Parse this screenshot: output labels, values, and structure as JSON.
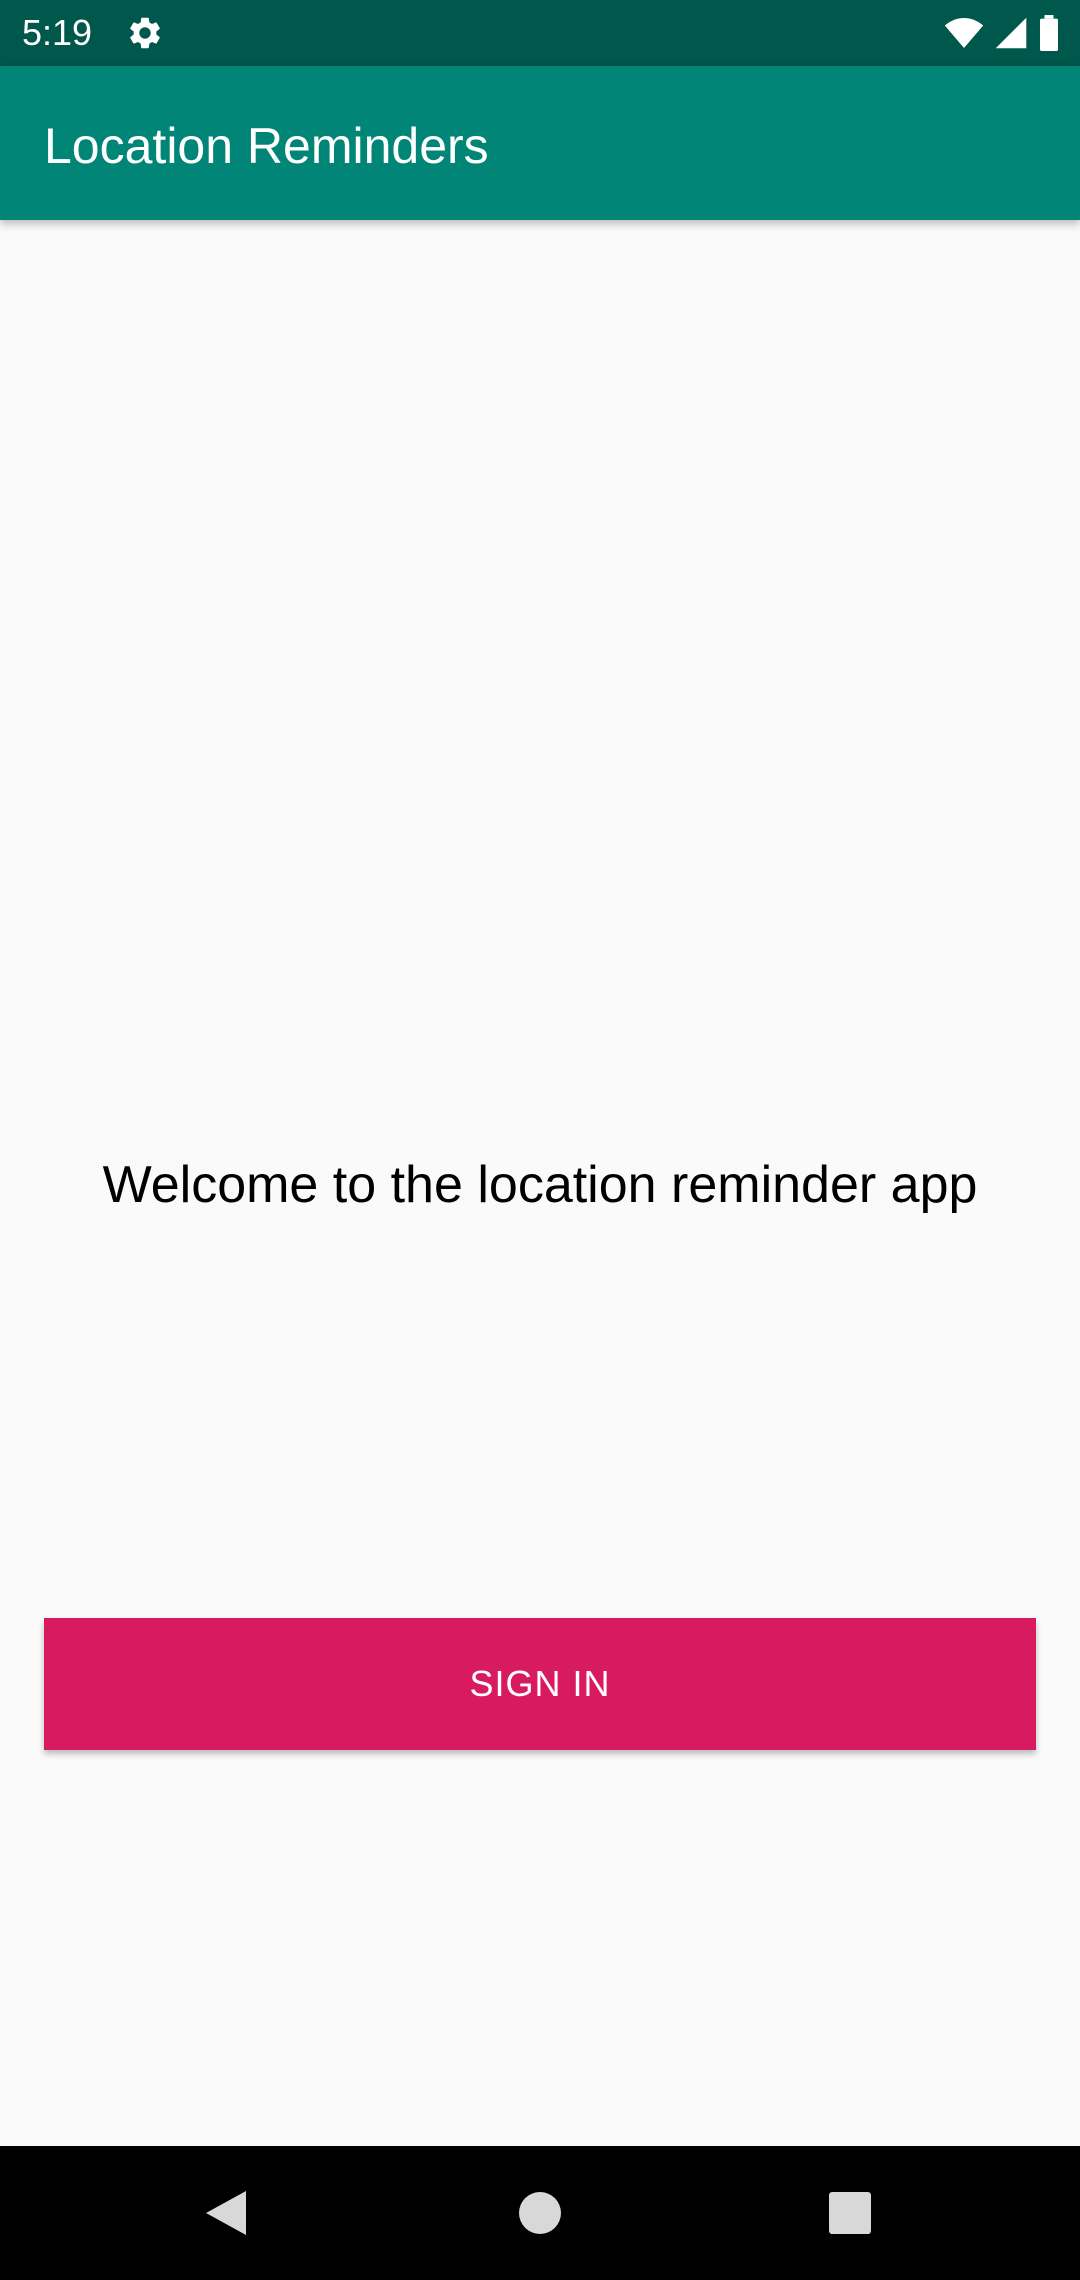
{
  "status_bar": {
    "time": "5:19",
    "icons": [
      "gear-icon",
      "wifi-icon",
      "signal-icon",
      "battery-icon"
    ],
    "background": "#00574b"
  },
  "app_bar": {
    "title": "Location Reminders",
    "background": "#008577"
  },
  "main": {
    "welcome_text": "Welcome to the location reminder app",
    "sign_in_label": "SIGN IN",
    "accent": "#d81b60"
  },
  "nav_bar": {
    "icons": [
      "back-icon",
      "home-icon",
      "recents-icon"
    ]
  }
}
